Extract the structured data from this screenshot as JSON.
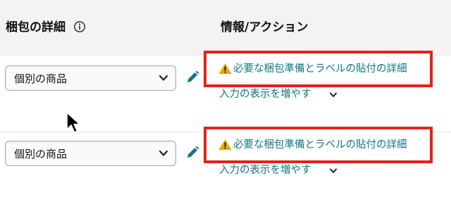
{
  "header": {
    "col1_title": "梱包の詳細",
    "col2_title": "情報/アクション"
  },
  "rows": [
    {
      "select_value": "個別の商品",
      "detail_link": "必要な梱包準備とラベルの貼付の詳細",
      "more_link": "入力の表示を増やす"
    },
    {
      "select_value": "個別の商品",
      "detail_link": "必要な梱包準備とラベルの貼付の詳細",
      "more_link": "入力の表示を増やす"
    }
  ],
  "icons": {
    "info": "info-circle-icon",
    "chevron": "chevron-down-icon",
    "edit": "pencil-icon",
    "warning": "warning-triangle-icon",
    "cursor": "mouse-pointer-icon"
  },
  "colors": {
    "link": "#0f7583",
    "annotation": "#e32219",
    "warning": "#f0a30a",
    "header_bg": "#f3f3f3"
  }
}
